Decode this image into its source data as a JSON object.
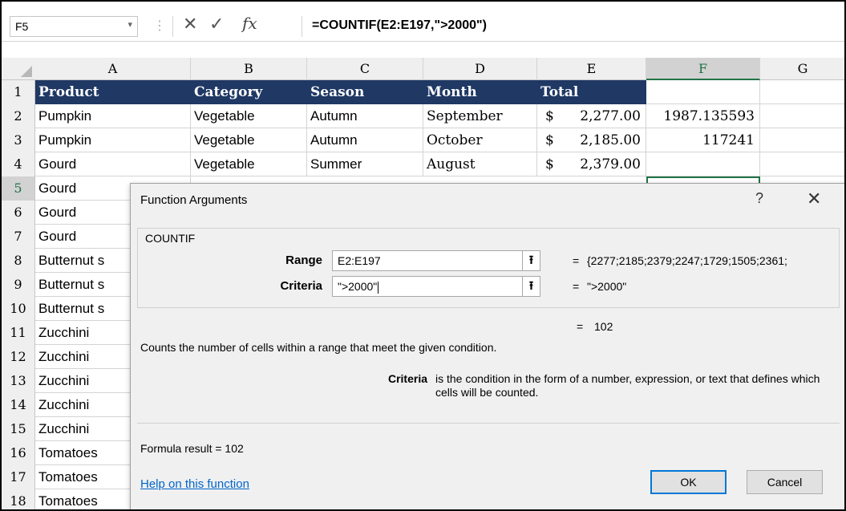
{
  "formula_bar": {
    "name_box": "F5",
    "name_box_dropdown_icon": "chevron-down",
    "cancel_icon": "✕",
    "enter_icon": "✓",
    "fx_label": "fx",
    "formula": "=COUNTIF(E2:E197,\">2000\")"
  },
  "columns": [
    "A",
    "B",
    "C",
    "D",
    "E",
    "F",
    "G"
  ],
  "selected_column": "F",
  "rows": [
    {
      "num": "1",
      "cells": [
        "Product",
        "Category",
        "Season",
        "Month",
        "Total",
        "",
        ""
      ]
    },
    {
      "num": "2",
      "cells": [
        "Pumpkin",
        "Vegetable",
        "Autumn",
        "September",
        "2,277.00",
        "1987.135593",
        ""
      ]
    },
    {
      "num": "3",
      "cells": [
        "Pumpkin",
        "Vegetable",
        "Autumn",
        "October",
        "2,185.00",
        "117241",
        ""
      ]
    },
    {
      "num": "4",
      "cells": [
        "Gourd",
        "Vegetable",
        "Summer",
        "August",
        "2,379.00",
        "",
        ""
      ]
    },
    {
      "num": "5",
      "cells": [
        "Gourd"
      ]
    },
    {
      "num": "6",
      "cells": [
        "Gourd"
      ]
    },
    {
      "num": "7",
      "cells": [
        "Gourd"
      ]
    },
    {
      "num": "8",
      "cells": [
        "Butternut s"
      ]
    },
    {
      "num": "9",
      "cells": [
        "Butternut s"
      ]
    },
    {
      "num": "10",
      "cells": [
        "Butternut s"
      ]
    },
    {
      "num": "11",
      "cells": [
        "Zucchini"
      ]
    },
    {
      "num": "12",
      "cells": [
        "Zucchini"
      ]
    },
    {
      "num": "13",
      "cells": [
        "Zucchini"
      ]
    },
    {
      "num": "14",
      "cells": [
        "Zucchini"
      ]
    },
    {
      "num": "15",
      "cells": [
        "Zucchini"
      ]
    },
    {
      "num": "16",
      "cells": [
        "Tomatoes"
      ]
    },
    {
      "num": "17",
      "cells": [
        "Tomatoes"
      ]
    },
    {
      "num": "18",
      "cells": [
        "Tomatoes"
      ]
    }
  ],
  "currency_symbol": "$",
  "dialog": {
    "title": "Function Arguments",
    "help_icon": "?",
    "close_icon": "✕",
    "function_name": "COUNTIF",
    "args": [
      {
        "label": "Range",
        "value": "E2:E197",
        "equals": "=",
        "result": "{2277;2185;2379;2247;1729;1505;2361;"
      },
      {
        "label": "Criteria",
        "value": "\">2000\"",
        "equals": "=",
        "result": "\">2000\""
      }
    ],
    "collapse_icon": "⭱",
    "result_equals": "=",
    "result_value": "102",
    "description": "Counts the number of cells within a range that meet the given condition.",
    "arg_help_label": "Criteria",
    "arg_help_text": "is the condition in the form of a number, expression, or text that defines which cells will be counted.",
    "formula_result_label": "Formula result =   102",
    "help_link": "Help on this function",
    "ok_label": "OK",
    "cancel_label": "Cancel"
  },
  "colors": {
    "header_fill": "#1f3864",
    "selection_green": "#217346",
    "link_blue": "#0066cc",
    "ok_border": "#0078d7"
  }
}
